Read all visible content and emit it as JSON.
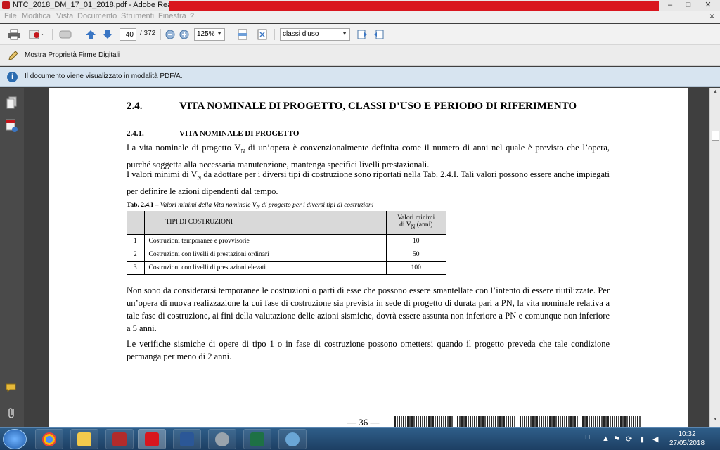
{
  "window": {
    "title": "NTC_2018_DM_17_01_2018.pdf - Adobe Reader",
    "controls": {
      "minimize": "–",
      "maximize": "□",
      "close": "✕"
    }
  },
  "menu": {
    "items": [
      "File",
      "Modifica",
      "Vista",
      "Documento",
      "Strumenti",
      "Finestra",
      "?"
    ],
    "close_doc": "×"
  },
  "toolbar": {
    "page_current": "40",
    "page_total": "/ 372",
    "zoom": "125%",
    "bookmark_select": "classi d'uso"
  },
  "signatures_bar": {
    "label": "Mostra Proprietà Firme Digitali"
  },
  "info_bar": {
    "icon": "i",
    "message": "Il documento viene visualizzato in modalità PDF/A."
  },
  "document": {
    "section": {
      "number": "2.4.",
      "title": "VITA NOMINALE DI PROGETTO, CLASSI D’USO E PERIODO DI RIFERIMENTO"
    },
    "subsection": {
      "number": "2.4.1.",
      "title": "VITA NOMINALE DI PROGETTO"
    },
    "para1": {
      "a": "La vita nominale di progetto V",
      "sub": "N",
      "b": " di un’opera è convenzionalmente definita come il numero di anni nel quale è previsto che l’opera, purché soggetta alla necessaria manutenzione, mantenga specifici livelli prestazionali."
    },
    "para2": {
      "a": "I valori minimi di V",
      "sub": "N",
      "b": " da adottare per i diversi tipi di costruzione sono riportati nella Tab. 2.4.I. Tali valori possono essere anche impiegati per definire le azioni dipendenti dal tempo."
    },
    "caption": {
      "label": "Tab. 2.4.I –",
      "text_a": " Valori minimi della Vita nominale V",
      "sub": "N",
      "text_b": " di progetto per i diversi tipi di costruzioni"
    },
    "table": {
      "header_type": "TIPI DI COSTRUZIONI",
      "header_value_line1": "Valori minimi",
      "header_value_line2a": "di V",
      "header_value_sub": "N",
      "header_value_line2b": " (anni)",
      "rows": [
        {
          "n": "1",
          "type": "Costruzioni temporanee e provvisorie",
          "value": "10"
        },
        {
          "n": "2",
          "type": "Costruzioni con livelli di prestazioni ordinari",
          "value": "50"
        },
        {
          "n": "3",
          "type": "Costruzioni con livelli di prestazioni elevati",
          "value": "100"
        }
      ]
    },
    "para3": "Non sono da considerarsi temporanee le costruzioni o parti di esse che possono essere smantellate con l’intento di essere riutilizzate. Per un’opera di nuova realizzazione la cui fase di costruzione sia prevista in sede di progetto di durata pari a PN, la vita nominale relativa a tale fase di costruzione, ai fini della valutazione delle azioni sismiche, dovrà essere assunta non inferiore a PN e comunque non inferiore a 5 anni.",
    "para4": "Le verifiche sismiche di opere di tipo 1 o in fase di costruzione possono omettersi quando il progetto preveda che tale condizione permanga per meno di 2 anni.",
    "page_number": "— 36 —"
  },
  "taskbar": {
    "language": "IT",
    "time": "10:32",
    "date": "27/05/2018"
  },
  "colors": {
    "info_bar_bg": "#d7e4f0",
    "title_red": "#d9161e",
    "taskbar": "#1d3f63"
  }
}
